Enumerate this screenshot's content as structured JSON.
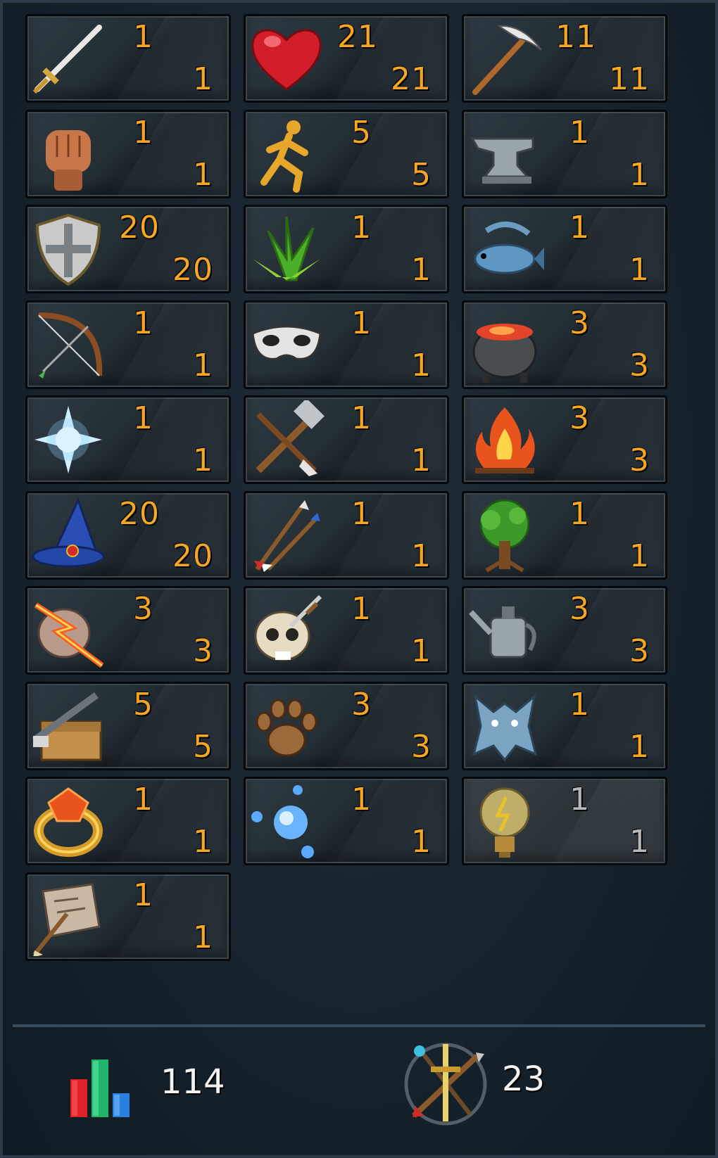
{
  "skills": [
    {
      "id": "attack",
      "icon": "sword-icon",
      "current": "1",
      "max": "1"
    },
    {
      "id": "constitution",
      "icon": "heart-icon",
      "current": "21",
      "max": "21"
    },
    {
      "id": "mining",
      "icon": "pickaxe-icon",
      "current": "11",
      "max": "11"
    },
    {
      "id": "strength",
      "icon": "fist-icon",
      "current": "1",
      "max": "1"
    },
    {
      "id": "agility",
      "icon": "running-man-icon",
      "current": "5",
      "max": "5"
    },
    {
      "id": "smithing",
      "icon": "anvil-icon",
      "current": "1",
      "max": "1"
    },
    {
      "id": "defence",
      "icon": "shield-icon",
      "current": "20",
      "max": "20"
    },
    {
      "id": "herblore",
      "icon": "herb-icon",
      "current": "1",
      "max": "1"
    },
    {
      "id": "fishing",
      "icon": "fish-icon",
      "current": "1",
      "max": "1"
    },
    {
      "id": "ranged",
      "icon": "bow-icon",
      "current": "1",
      "max": "1"
    },
    {
      "id": "thieving",
      "icon": "mask-icon",
      "current": "1",
      "max": "1"
    },
    {
      "id": "cooking",
      "icon": "cauldron-icon",
      "current": "3",
      "max": "3"
    },
    {
      "id": "prayer",
      "icon": "star-icon",
      "current": "1",
      "max": "1"
    },
    {
      "id": "crafting",
      "icon": "hammer-chisel-icon",
      "current": "1",
      "max": "1"
    },
    {
      "id": "firemaking",
      "icon": "fire-icon",
      "current": "3",
      "max": "3"
    },
    {
      "id": "magic",
      "icon": "wizard-hat-icon",
      "current": "20",
      "max": "20"
    },
    {
      "id": "fletching",
      "icon": "arrows-icon",
      "current": "1",
      "max": "1"
    },
    {
      "id": "woodcutting",
      "icon": "tree-icon",
      "current": "1",
      "max": "1"
    },
    {
      "id": "runecrafting",
      "icon": "rune-rock-icon",
      "current": "3",
      "max": "3"
    },
    {
      "id": "slayer",
      "icon": "skull-dagger-icon",
      "current": "1",
      "max": "1"
    },
    {
      "id": "farming",
      "icon": "watering-can-icon",
      "current": "3",
      "max": "3"
    },
    {
      "id": "construction",
      "icon": "toolbox-icon",
      "current": "5",
      "max": "5"
    },
    {
      "id": "hunter",
      "icon": "paw-print-icon",
      "current": "3",
      "max": "3"
    },
    {
      "id": "summoning",
      "icon": "wolf-icon",
      "current": "1",
      "max": "1"
    },
    {
      "id": "dungeoneering",
      "icon": "ring-icon",
      "current": "1",
      "max": "1"
    },
    {
      "id": "divination",
      "icon": "orbs-icon",
      "current": "1",
      "max": "1"
    },
    {
      "id": "invention",
      "icon": "lightbulb-icon",
      "current": "1",
      "max": "1",
      "grey": true
    },
    {
      "id": "archaeology",
      "icon": "scroll-brush-icon",
      "current": "1",
      "max": "1"
    }
  ],
  "footer": {
    "total_level": "114",
    "total_icon": "bar-chart-icon",
    "combat_level": "23",
    "combat_icon": "combat-weapons-icon"
  },
  "colors": {
    "level_text": "#f5a623",
    "footer_text": "#f2f2f2",
    "background": "#16222c"
  }
}
